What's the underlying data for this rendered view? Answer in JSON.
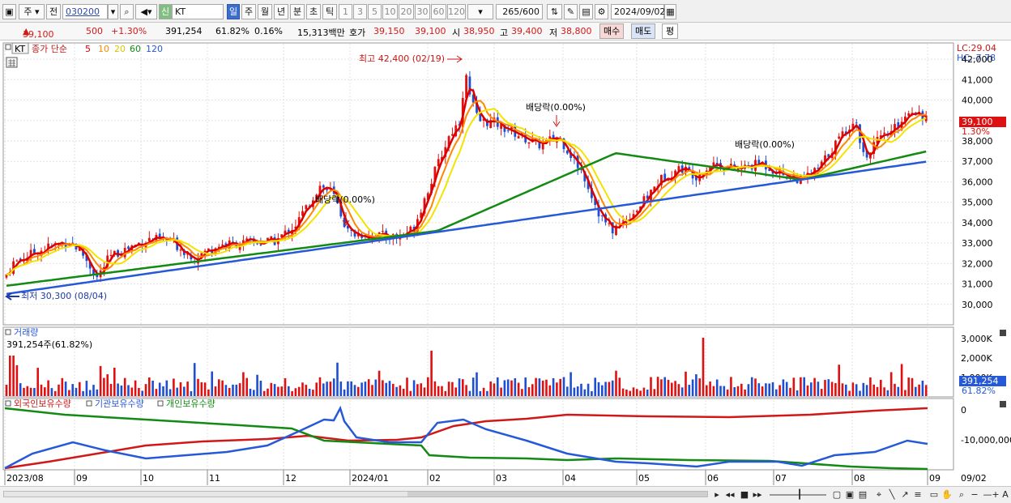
{
  "toolbar": {
    "period_sel": "주",
    "prev_label": "전",
    "stock_code": "030200",
    "shin_label": "신",
    "stock_name": "KT",
    "periods": [
      "일",
      "주",
      "월",
      "년",
      "분",
      "초",
      "틱"
    ],
    "numbers": [
      "1",
      "3",
      "5",
      "10",
      "20",
      "30",
      "60",
      "120"
    ],
    "count": "265",
    "count_total": "/600",
    "date": "2024/09/02"
  },
  "info": {
    "price": "39,100",
    "change": "500",
    "change_pct": "+1.30%",
    "volume": "391,254",
    "volume_ratio": "61.82%",
    "turnover_rate": "0.16%",
    "amount": "15,313백만",
    "ask_label": "호가",
    "ask1": "39,150",
    "ask2": "39,100",
    "open_label": "시",
    "open": "38,950",
    "high_label": "고",
    "high": "39,400",
    "low_label": "저",
    "low": "38,800",
    "buy_btn": "매수",
    "sell_btn": "매도",
    "eval_btn": "평"
  },
  "main_legend": {
    "stock": "KT",
    "label": "종가 단순",
    "ma": [
      {
        "period": "5",
        "color": "#dd0000"
      },
      {
        "period": "10",
        "color": "#ff8800"
      },
      {
        "period": "20",
        "color": "#e8d800"
      },
      {
        "period": "60",
        "color": "#138a13"
      },
      {
        "period": "120",
        "color": "#2659d8"
      }
    ]
  },
  "annotations": {
    "high": "최고 42,400 (02/19)",
    "low": "최저 30,300 (08/04)",
    "div1": "배당락(0.00%)",
    "div2": "배당락(0.00%)",
    "div3": "배당락(0.00%)",
    "lc": "LC:29.04",
    "hc": "HC:-7.78",
    "cur_price": "39,100",
    "cur_pct": "1.30%"
  },
  "price_axis": [
    "42,000",
    "41,000",
    "40,000",
    "39,000",
    "38,000",
    "37,000",
    "36,000",
    "35,000",
    "34,000",
    "33,000",
    "32,000",
    "31,000",
    "30,000"
  ],
  "volume_panel": {
    "title": "거래량",
    "sub": "391,254주(61.82%)",
    "axis": [
      "3,000K",
      "2,000K",
      "1,000K"
    ],
    "cur": "391,254",
    "cur_pct": "61.82%"
  },
  "holdings_panel": {
    "legend": [
      {
        "name": "외국인보유수량",
        "color": "#d01818"
      },
      {
        "name": "기관보유수량",
        "color": "#2659d8"
      },
      {
        "name": "개인보유수량",
        "color": "#138a13"
      }
    ],
    "axis": [
      "0",
      "-10,000,000"
    ]
  },
  "x_axis": [
    "2023/08",
    "09",
    "10",
    "11",
    "12",
    "2024/01",
    "02",
    "03",
    "04",
    "05",
    "06",
    "07",
    "08",
    "09"
  ],
  "x_last": "09/02",
  "colors": {
    "up": "#e01010",
    "down": "#1f4fd0",
    "price_tag_bg": "#dd1111"
  }
}
